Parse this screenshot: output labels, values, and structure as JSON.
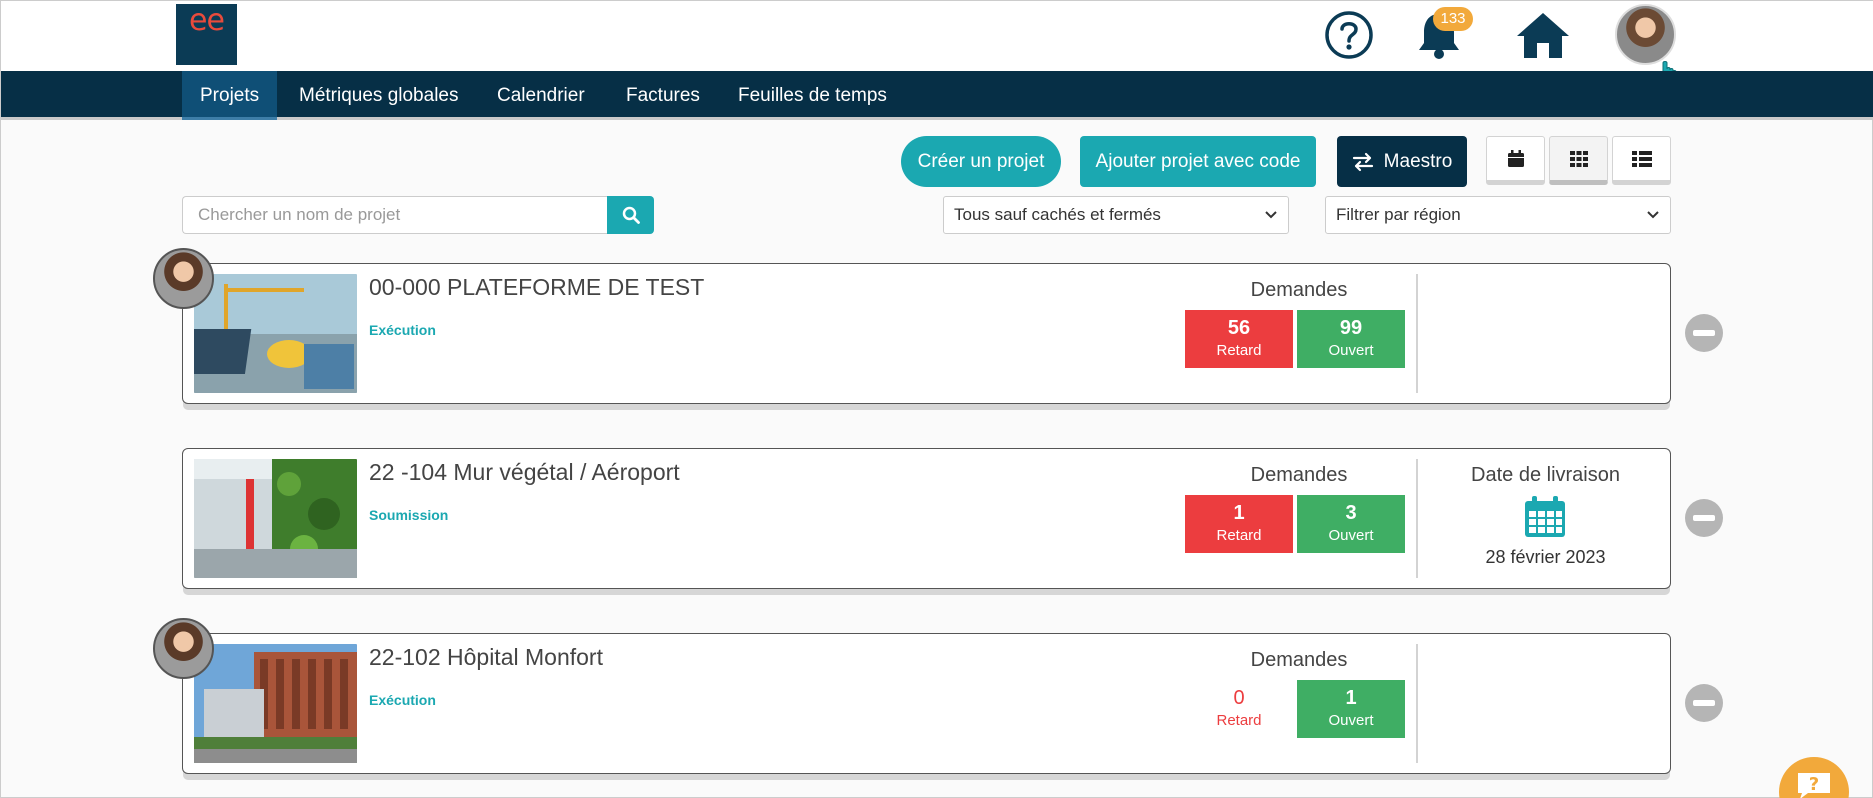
{
  "header": {
    "logo_text": "ee",
    "notifications_count": "133",
    "icons": [
      "help-icon",
      "bell-icon",
      "home-icon"
    ],
    "colors": {
      "brand_dark": "#062f46",
      "accent": "#1ba8b1",
      "badge": "#f2a93b"
    }
  },
  "nav": {
    "items": [
      "Projets",
      "Métriques globales",
      "Calendrier",
      "Factures",
      "Feuilles de temps"
    ],
    "active": "Projets"
  },
  "toolbar": {
    "create_label": "Créer un projet",
    "add_code_label": "Ajouter projet avec code",
    "maestro_label": "Maestro",
    "views": [
      "calendar-view",
      "grid-view",
      "list-view"
    ],
    "active_view": "grid-view"
  },
  "filters": {
    "search_placeholder": "Chercher un nom de projet",
    "status_selected": "Tous sauf cachés et fermés",
    "region_selected": "Filtrer par région"
  },
  "projects": [
    {
      "title": "00-000 PLATEFORME DE TEST",
      "phase": "Exécution",
      "requests_label": "Demandes",
      "late_count": "56",
      "late_label": "Retard",
      "open_count": "99",
      "open_label": "Ouvert"
    },
    {
      "title": "22 -104 Mur végétal / Aéroport",
      "phase": "Soumission",
      "requests_label": "Demandes",
      "late_count": "1",
      "late_label": "Retard",
      "open_count": "3",
      "open_label": "Ouvert",
      "delivery_label": "Date de livraison",
      "delivery_date": "28 février 2023"
    },
    {
      "title": "22-102 Hôpital Monfort",
      "phase": "Exécution",
      "requests_label": "Demandes",
      "late_count": "0",
      "late_label": "Retard",
      "open_count": "1",
      "open_label": "Ouvert"
    }
  ]
}
